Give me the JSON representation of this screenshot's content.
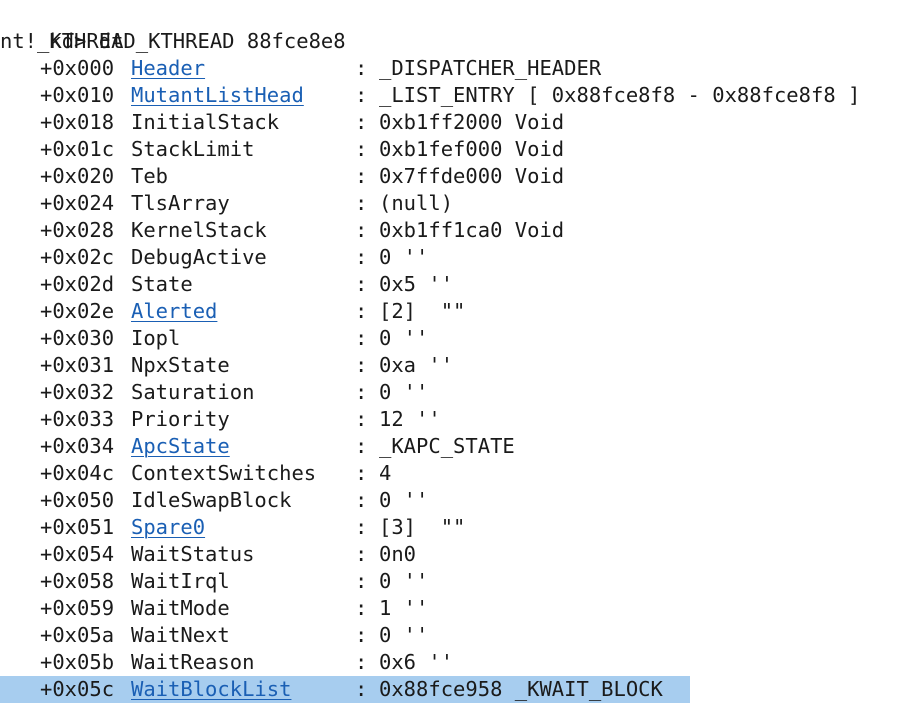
{
  "command": {
    "prompt": "kd>",
    "text": "dt _KTHREAD 88fce8e8"
  },
  "type_name": "nt!_KTHREAD",
  "fields": [
    {
      "offset": "+0x000",
      "name": "Header",
      "link": true,
      "value": "_DISPATCHER_HEADER"
    },
    {
      "offset": "+0x010",
      "name": "MutantListHead",
      "link": true,
      "value": "_LIST_ENTRY [ 0x88fce8f8 - 0x88fce8f8 ]"
    },
    {
      "offset": "+0x018",
      "name": "InitialStack",
      "link": false,
      "value": "0xb1ff2000 Void"
    },
    {
      "offset": "+0x01c",
      "name": "StackLimit",
      "link": false,
      "value": "0xb1fef000 Void"
    },
    {
      "offset": "+0x020",
      "name": "Teb",
      "link": false,
      "value": "0x7ffde000 Void"
    },
    {
      "offset": "+0x024",
      "name": "TlsArray",
      "link": false,
      "value": "(null)"
    },
    {
      "offset": "+0x028",
      "name": "KernelStack",
      "link": false,
      "value": "0xb1ff1ca0 Void"
    },
    {
      "offset": "+0x02c",
      "name": "DebugActive",
      "link": false,
      "value": "0 ''"
    },
    {
      "offset": "+0x02d",
      "name": "State",
      "link": false,
      "value": "0x5 ''"
    },
    {
      "offset": "+0x02e",
      "name": "Alerted",
      "link": true,
      "value": "[2]  \"\""
    },
    {
      "offset": "+0x030",
      "name": "Iopl",
      "link": false,
      "value": "0 ''"
    },
    {
      "offset": "+0x031",
      "name": "NpxState",
      "link": false,
      "value": "0xa ''"
    },
    {
      "offset": "+0x032",
      "name": "Saturation",
      "link": false,
      "value": "0 ''"
    },
    {
      "offset": "+0x033",
      "name": "Priority",
      "link": false,
      "value": "12 ''"
    },
    {
      "offset": "+0x034",
      "name": "ApcState",
      "link": true,
      "value": "_KAPC_STATE"
    },
    {
      "offset": "+0x04c",
      "name": "ContextSwitches",
      "link": false,
      "value": "4"
    },
    {
      "offset": "+0x050",
      "name": "IdleSwapBlock",
      "link": false,
      "value": "0 ''"
    },
    {
      "offset": "+0x051",
      "name": "Spare0",
      "link": true,
      "value": "[3]  \"\""
    },
    {
      "offset": "+0x054",
      "name": "WaitStatus",
      "link": false,
      "value": "0n0"
    },
    {
      "offset": "+0x058",
      "name": "WaitIrql",
      "link": false,
      "value": "0 ''"
    },
    {
      "offset": "+0x059",
      "name": "WaitMode",
      "link": false,
      "value": "1 ''"
    },
    {
      "offset": "+0x05a",
      "name": "WaitNext",
      "link": false,
      "value": "0 ''"
    },
    {
      "offset": "+0x05b",
      "name": "WaitReason",
      "link": false,
      "value": "0x6 ''"
    },
    {
      "offset": "+0x05c",
      "name": "WaitBlockList",
      "link": true,
      "highlighted": true,
      "value": "0x88fce958 _KWAIT_BLOCK"
    }
  ],
  "colors": {
    "text": "#1a1a1a",
    "link": "#1a5fb4",
    "highlight": "#a7cdef",
    "background": "#ffffff"
  }
}
